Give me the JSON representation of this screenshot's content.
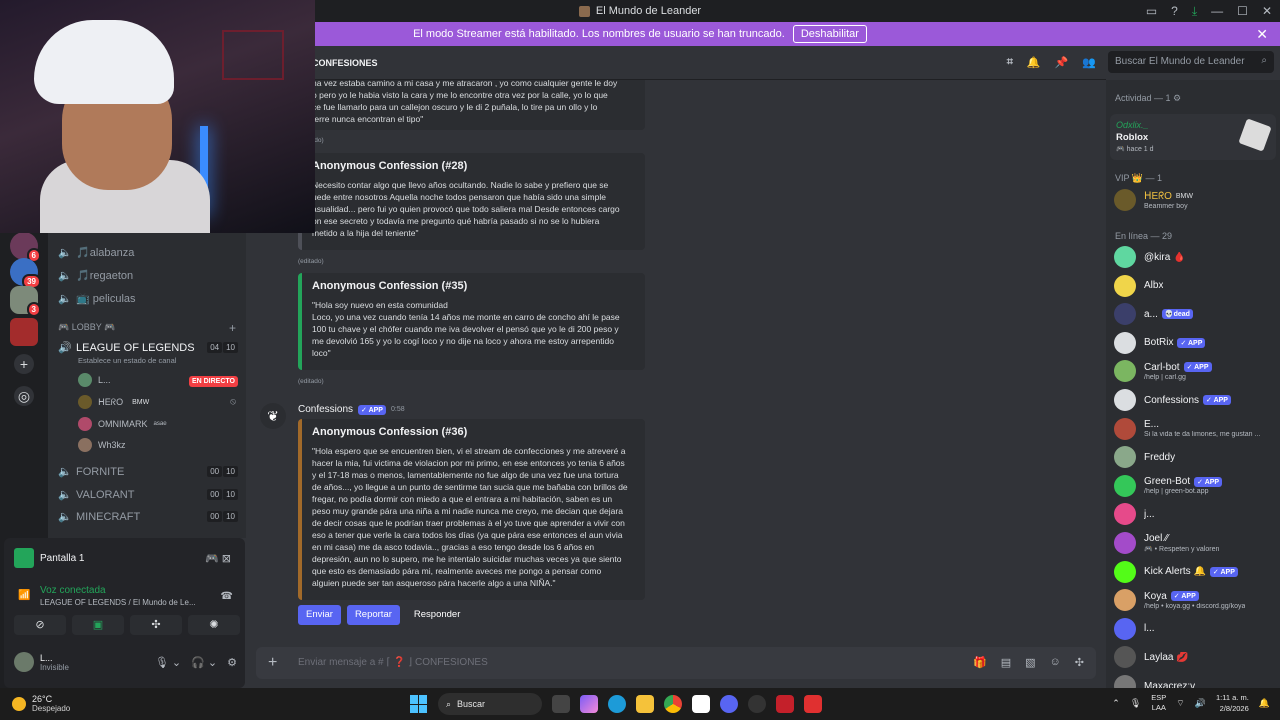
{
  "window": {
    "title": "El Mundo de Leander"
  },
  "banner": {
    "text": "El modo Streamer está habilitado. Los nombres de usuario se han truncado.",
    "button": "Deshabilitar"
  },
  "channel_header": {
    "name": "CONFESIONES"
  },
  "search": {
    "placeholder": "Buscar El Mundo de Leander"
  },
  "servers": [
    {
      "badge": "6"
    },
    {
      "badge": "39"
    },
    {
      "badge": "3"
    }
  ],
  "channels": {
    "voice": [
      "🎵alabanza",
      "🎵regaeton",
      "📺 peliculas"
    ],
    "lobby_category": "🎮 LOBBY 🎮",
    "lol": {
      "name": "LEAGUE OF LEGENDS",
      "status_hint": "Establece un estado de canal",
      "count_a": "04",
      "count_b": "10"
    },
    "voice_users": [
      {
        "name": "L...",
        "tag": "EN DIRECTO"
      },
      {
        "name": "ᕼEᖇO",
        "tag": "BMW"
      },
      {
        "name": "OMNIMARK",
        "tag": "ᵃˢᵃᵉ"
      },
      {
        "name": "Wh3kz",
        "tag": ""
      }
    ],
    "others": [
      {
        "name": "FORNITE",
        "a": "00",
        "b": "10"
      },
      {
        "name": "VALORANT",
        "a": "00",
        "b": "10"
      },
      {
        "name": "MINECRAFT",
        "a": "00",
        "b": "10"
      }
    ]
  },
  "voice_panel": {
    "screen_label": "Pantalla 1",
    "connected": "Voz conectada",
    "location": "LEAGUE OF LEGENDS / El Mundo de Le...",
    "user_name": "L...",
    "user_status": "Invisible"
  },
  "chat": {
    "embed0_text": "na vez estaba camino a mi casa y me atracaron , yo como cualquier gente le doy\no pero yo le habia visto la cara y me lo encontre otra vez por la calle, yo lo que\nce fue llamarlo para un callejon oscuro y le di 2 puñala, lo tire pa un ollo y lo\nterre nunca encontran el tipo\"",
    "edited0": "(editado)",
    "embed1_title": "Anonymous Confession (#28)",
    "embed1_text": "Necesito contar algo que llevo años ocultando. Nadie lo sabe y prefiero que se\nuede entre nosotros Aquella noche todos pensaron que había sido una simple\nasualidad... pero fui yo quien provocó que todo saliera mal Desde entonces cargo\non ese secreto y todavía me pregunto qué habría pasado si no se lo hubiera\nmetido a la hija del teniente\"",
    "edited1": "(editado)",
    "embed2_title": "Anonymous Confession (#35)",
    "embed2_text": "\"Hola soy nuevo en esta comunidad\nLoco, yo una vez cuando tenía 14 años me monte en carro de concho ahí le pase\n100 tu chave y el chófer cuando me iva devolver el pensó que yo le di 200 peso y\nme devolvió 165 y yo lo cogí loco y no dije na loco y ahora me estoy arrepentido\nloco\"",
    "edited2": "(editado)",
    "author": "Confessions",
    "author_tag": "✓ APP",
    "time": "0:58",
    "embed3_title": "Anonymous Confession (#36)",
    "embed3_text": "\"Hola espero que se encuentren bien, vi el stream de confecciones y me atreveré a\nhacer la mia, fui victima de violacion por mi primo, en ese entonces yo tenia 6 años\ny el 17-18 mas o menos, lamentablemente no fue algo de una vez fue una tortura\nde años..., yo llegue a un punto de sentirme tan sucia que me bañaba con brillos de\nfregar, no podía dormir con miedo a que el entrara a mi habitación, saben es un\npeso muy grande pára una niña a mi nadie nunca me creyo, me decian que dejara\nde decir cosas que le podrían traer problemas à el yo tuve que aprender a vivir con\neso a tener que verle la cara todos los días (ya que pára ese entonces el aun vivia\nen mi casa) me da asco todavia.., gracias a eso tengo desde los 6 años en\ndepresión, aun no lo supero, me he intentalo suicidar muchas veces ya que siento\nque esto es demasiado pára mi, realmente aveces me pongo a pensar como\nalguien puede ser tan asqueroso pára hacerle algo a una NIÑA.\"",
    "actions": [
      "Enviar",
      "Reportar",
      "Responder"
    ]
  },
  "composer": {
    "placeholder": "Enviar mensaje a # ⌈ ❓ ⌋ CONFESIONES"
  },
  "members": {
    "activity_header": "Actividad — 1 ⚙",
    "activity": {
      "name": "Odxlix._",
      "game": "Roblox",
      "time": "🎮 hace 1 d"
    },
    "vip_header": "VIP 👑 — 1",
    "vip": [
      {
        "name": "ᕼEᖇO",
        "tag": "BMW",
        "status": "Beammer boy"
      }
    ],
    "online_header": "En línea — 29",
    "online": [
      {
        "name": "@kira 🩸",
        "tag": "",
        "status": "",
        "color": "#5fd7a0"
      },
      {
        "name": "Albx",
        "tag": "",
        "status": "",
        "color": "#f0d54a"
      },
      {
        "name": "a...",
        "tag": "💀dead",
        "status": "",
        "color": "#3b3f6a"
      },
      {
        "name": "BotRix",
        "tag": "✓ APP",
        "status": "",
        "color": "#dbdee1"
      },
      {
        "name": "Carl-bot",
        "tag": "✓ APP",
        "status": "/help | carl.gg",
        "color": "#7bb661"
      },
      {
        "name": "Confessions",
        "tag": "✓ APP",
        "status": "",
        "color": "#dbdee1"
      },
      {
        "name": "E...",
        "tag": "",
        "status": "Si la vida te da limones, me gustan ...",
        "color": "#b04a3a"
      },
      {
        "name": "Freddy",
        "tag": "",
        "status": "",
        "color": "#8aa88a"
      },
      {
        "name": "Green-Bot",
        "tag": "✓ APP",
        "status": "/help | green-bot.app",
        "color": "#34c759"
      },
      {
        "name": "j...",
        "tag": "",
        "status": "",
        "color": "#e64a8a"
      },
      {
        "name": "Joel ⁄⁄",
        "tag": "",
        "status": "🎮 • Respeten y valoren",
        "color": "#a34bc9"
      },
      {
        "name": "Kick Alerts 🔔",
        "tag": "✓ APP",
        "status": "",
        "color": "#53fc18"
      },
      {
        "name": "Koya",
        "tag": "✓ APP",
        "status": "/help • koya.gg • discord.gg/koya",
        "color": "#d9a066"
      },
      {
        "name": "l...",
        "tag": "",
        "status": "",
        "color": "#5865f2"
      },
      {
        "name": "Laylaa 💋",
        "tag": "",
        "status": "",
        "color": "#555"
      },
      {
        "name": "Maxacrez:v",
        "tag": "",
        "status": "",
        "color": "#777"
      }
    ]
  },
  "taskbar": {
    "temp": "26°C",
    "condition": "Despejado",
    "search": "Buscar",
    "lang_a": "ESP",
    "lang_b": "LAA",
    "time": "1:11 a. m.",
    "date": "2/8/2026"
  }
}
